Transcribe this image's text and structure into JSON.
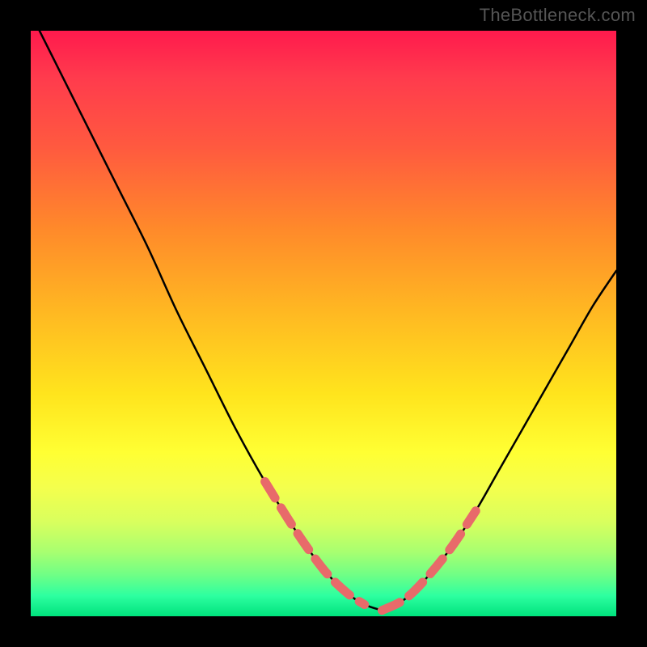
{
  "watermark": "TheBottleneck.com",
  "chart_data": {
    "type": "line",
    "title": "",
    "xlabel": "",
    "ylabel": "",
    "xlim": [
      0,
      100
    ],
    "ylim": [
      0,
      100
    ],
    "series": [
      {
        "name": "left-curve",
        "x": [
          1,
          5,
          10,
          15,
          20,
          25,
          30,
          35,
          40,
          45,
          50,
          54,
          57,
          60
        ],
        "y": [
          101,
          93,
          83,
          73,
          63,
          52,
          42,
          32,
          23,
          15,
          8,
          4,
          2,
          1
        ]
      },
      {
        "name": "right-curve",
        "x": [
          60,
          64,
          68,
          72,
          76,
          80,
          84,
          88,
          92,
          96,
          100
        ],
        "y": [
          1,
          3,
          7,
          12,
          18,
          25,
          32,
          39,
          46,
          53,
          59
        ]
      }
    ],
    "highlight_segments": [
      {
        "on": "left-curve",
        "x_range": [
          38,
          57
        ]
      },
      {
        "on": "right-curve",
        "x_range": [
          60,
          76
        ]
      }
    ],
    "colors": {
      "curve": "#000000",
      "highlight": "#e86a6a",
      "gradient_top": "#ff1a4d",
      "gradient_bottom": "#00e27d"
    }
  }
}
